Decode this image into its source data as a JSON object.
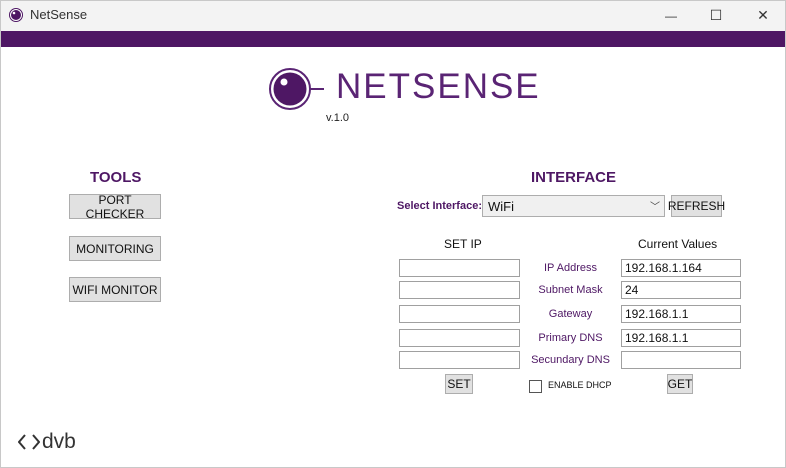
{
  "window": {
    "title": "NetSense",
    "accent": "#4e1764",
    "minimize_symbol": "—",
    "maximize_symbol": "☐",
    "close_symbol": "✕"
  },
  "logo": {
    "text": "NETSENSE",
    "version": "v.1.0",
    "icon": "lens-icon"
  },
  "tools": {
    "heading": "TOOLS",
    "buttons": [
      "PORT CHECKER",
      "MONITORING",
      "WIFI MONITOR"
    ]
  },
  "interface": {
    "heading": "INTERFACE",
    "select_label": "Select Interface:",
    "selected": "WiFi",
    "refresh_label": "REFRESH",
    "set_ip_title": "SET IP",
    "current_title": "Current Values",
    "rows": [
      {
        "label": "IP Address",
        "set_value": "",
        "current": "192.168.1.164"
      },
      {
        "label": "Subnet Mask",
        "set_value": "",
        "current": "24"
      },
      {
        "label": "Gateway",
        "set_value": "",
        "current": "192.168.1.1"
      },
      {
        "label": "Primary DNS",
        "set_value": "",
        "current": "192.168.1.1"
      },
      {
        "label": "Secundary DNS",
        "set_value": "",
        "current": ""
      }
    ],
    "set_label": "SET",
    "dhcp_label": "ENABLE DHCP",
    "dhcp_checked": false,
    "get_label": "GET"
  },
  "footer": {
    "brand": "dvb"
  }
}
